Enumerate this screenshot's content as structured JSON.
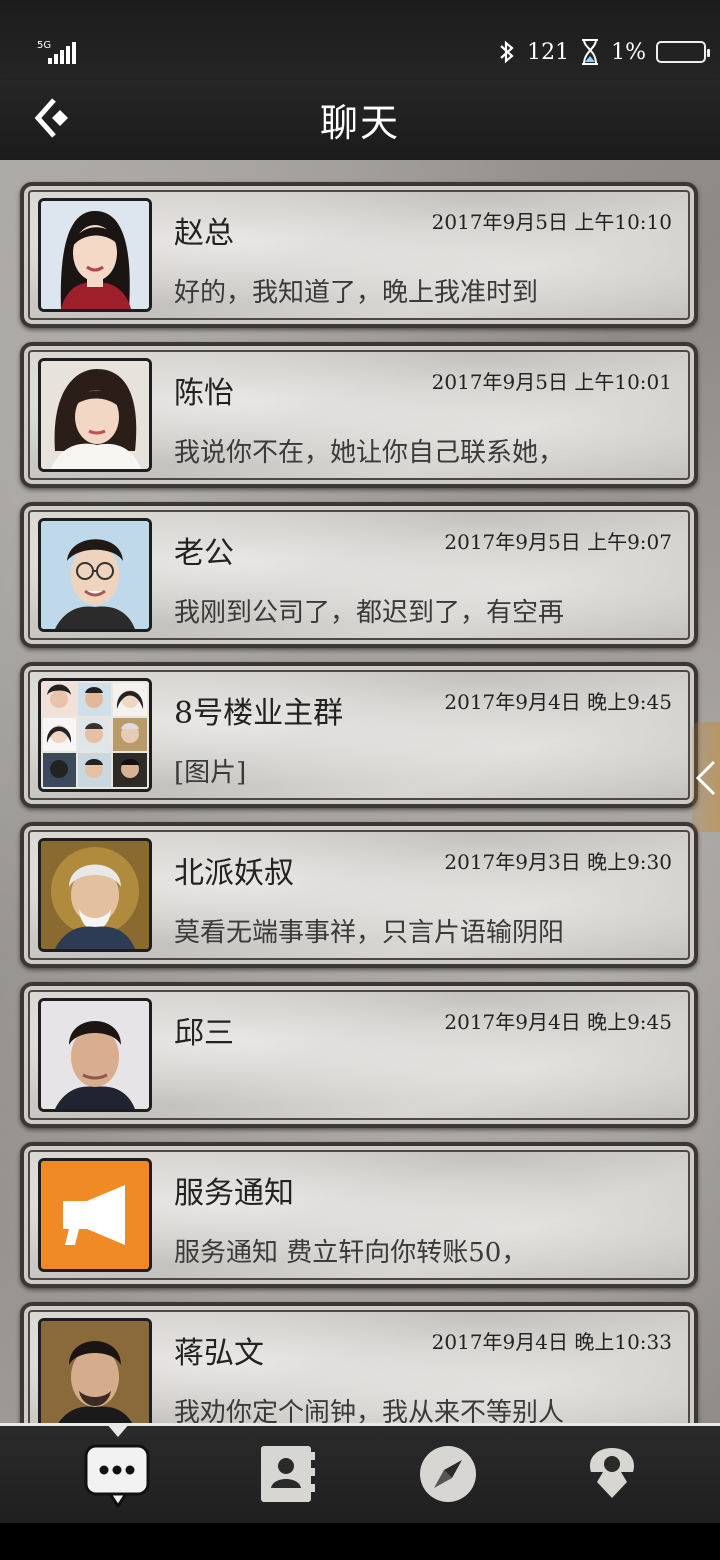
{
  "status_bar": {
    "network": "5G",
    "counter": "121",
    "battery": "1%"
  },
  "header": {
    "title": "聊天"
  },
  "chats": [
    {
      "name": "赵总",
      "time": "2017年9月5日 上午10:10",
      "preview": "好的，我知道了，晚上我准时到",
      "avatar": "woman-portrait"
    },
    {
      "name": "陈怡",
      "time": "2017年9月5日 上午10:01",
      "preview": "我说你不在，她让你自己联系她，",
      "avatar": "girl-portrait"
    },
    {
      "name": "老公",
      "time": "2017年9月5日 上午9:07",
      "preview": "我刚到公司了，都迟到了，有空再",
      "avatar": "man-glasses-portrait"
    },
    {
      "name": "8号楼业主群",
      "time": "2017年9月4日 晚上9:45",
      "preview": "[图片]",
      "avatar": "group-grid"
    },
    {
      "name": "北派妖叔",
      "time": "2017年9月3日 晚上9:30",
      "preview": "莫看无端事事祥，只言片语输阴阳",
      "avatar": "old-man-portrait"
    },
    {
      "name": "邱三",
      "time": "2017年9月4日 晚上9:45",
      "preview": "",
      "avatar": "man-portrait"
    },
    {
      "name": "服务通知",
      "time": "",
      "preview": "服务通知 费立轩向你转账50，",
      "avatar": "megaphone-icon"
    },
    {
      "name": "蒋弘文",
      "time": "2017年9月4日 晚上10:33",
      "preview": "我劝你定个闹钟，我从来不等别人",
      "avatar": "man-beard-portrait"
    }
  ],
  "tabs": [
    {
      "name": "chat",
      "icon": "chat-bubble-icon",
      "active": true
    },
    {
      "name": "contacts",
      "icon": "contacts-book-icon",
      "active": false
    },
    {
      "name": "discover",
      "icon": "compass-icon",
      "active": false
    },
    {
      "name": "me",
      "icon": "profile-badge-icon",
      "active": false
    }
  ],
  "colors": {
    "service_orange": "#f08a24",
    "card_border": "#3a3735",
    "bar_dark": "#1f1f1f"
  }
}
